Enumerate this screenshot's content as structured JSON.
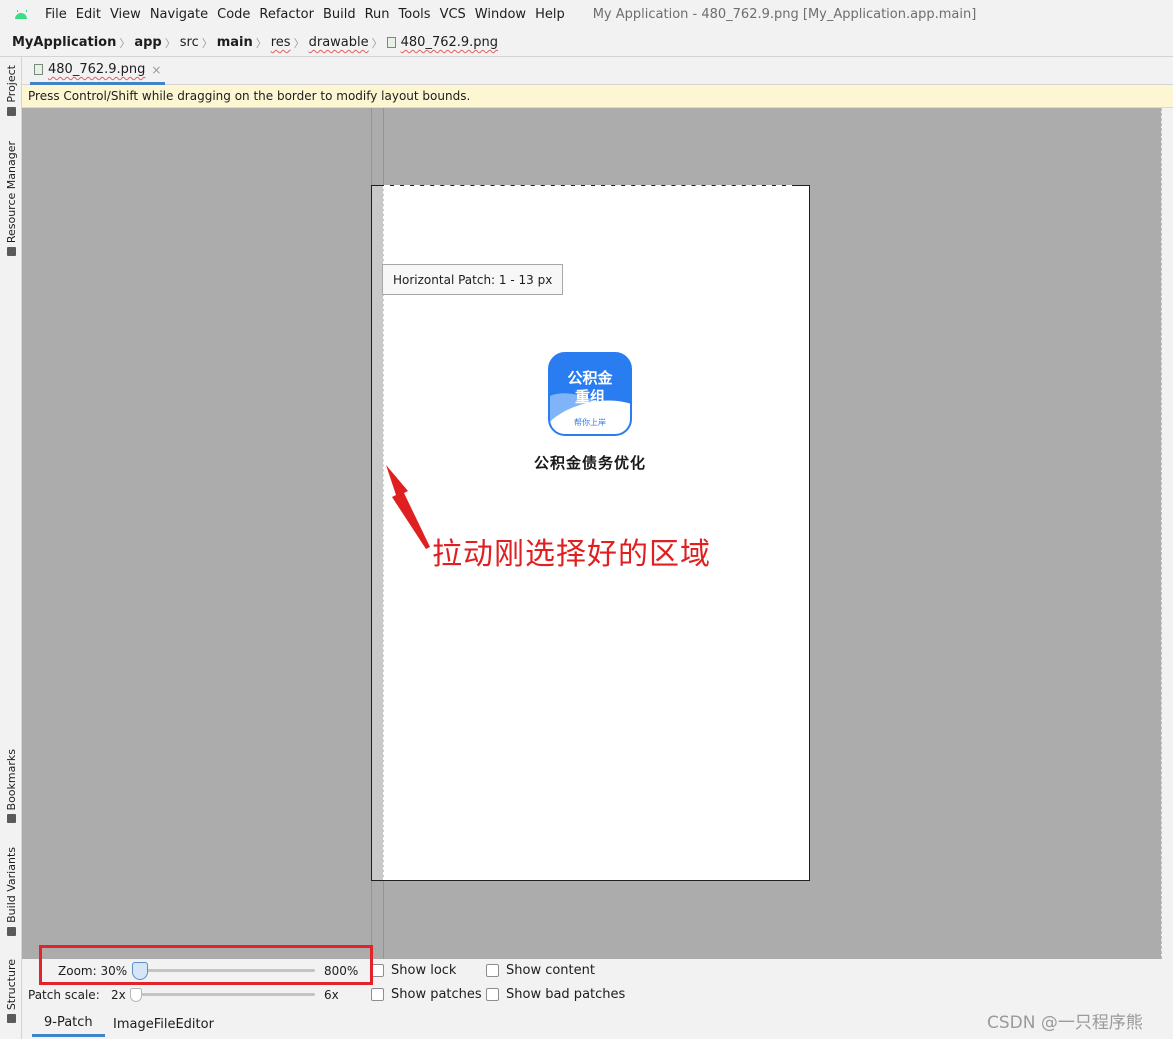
{
  "menu": {
    "items": [
      "File",
      "Edit",
      "View",
      "Navigate",
      "Code",
      "Refactor",
      "Build",
      "Run",
      "Tools",
      "VCS",
      "Window",
      "Help"
    ],
    "window_title": "My Application - 480_762.9.png [My_Application.app.main]"
  },
  "breadcrumb": {
    "project": "MyApplication",
    "module": "app",
    "src": "src",
    "main": "main",
    "res": "res",
    "drawable": "drawable",
    "file": "480_762.9.png"
  },
  "left_strip": {
    "project": "Project",
    "resource_manager": "Resource Manager",
    "bookmarks": "Bookmarks",
    "build_variants": "Build Variants",
    "structure": "Structure"
  },
  "editor_tab": {
    "label": "480_762.9.png",
    "close": "×"
  },
  "banner": {
    "text": "Press Control/Shift while dragging on the border to modify layout bounds."
  },
  "canvas": {
    "tooltip": "Horizontal Patch: 1 - 13 px",
    "icon_line1": "公积金",
    "icon_line2": "重组",
    "icon_line3": "帮你上岸",
    "icon_caption": "公积金债务优化",
    "annotation": "拉动刚选择好的区域",
    "annotation_color": "#e02020"
  },
  "controls": {
    "zoom_label": "Zoom: 30%",
    "zoom_max": "800%",
    "zoom_value_fraction": 0.03,
    "patch_scale_label": "Patch scale:",
    "patch_min": "2x",
    "patch_max": "6x",
    "patch_value_fraction": 0.0,
    "show_lock": "Show lock",
    "show_patches": "Show patches",
    "show_content": "Show content",
    "show_bad_patches": "Show bad patches"
  },
  "bottom_tabs": {
    "tab1": "9-Patch",
    "tab2": "ImageFileEditor"
  },
  "watermark": "CSDN @一只程序熊",
  "colors": {
    "accent": "#4083c9",
    "highlight_frame": "#e0242a",
    "canvas_bg": "#acacac"
  }
}
